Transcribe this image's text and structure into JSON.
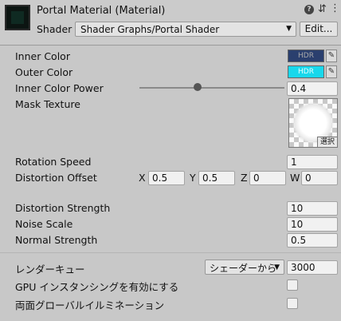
{
  "header": {
    "title": "Portal Material (Material)",
    "help_icon": "?",
    "shader_label": "Shader",
    "shader_value": "Shader Graphs/Portal Shader",
    "edit_label": "Edit..."
  },
  "properties": {
    "inner_color": {
      "label": "Inner Color",
      "hdr": "HDR",
      "color": "#2a3f6e"
    },
    "outer_color": {
      "label": "Outer Color",
      "hdr": "HDR",
      "color": "#18d8ec"
    },
    "inner_power": {
      "label": "Inner Color Power",
      "value": "0.4",
      "slider_fraction": 0.4
    },
    "mask_texture": {
      "label": "Mask Texture",
      "select_label": "選択"
    },
    "rotation_speed": {
      "label": "Rotation Speed",
      "value": "1"
    },
    "distortion_offset": {
      "label": "Distortion Offset",
      "x_label": "X",
      "x": "0.5",
      "y_label": "Y",
      "y": "0.5",
      "z_label": "Z",
      "z": "0",
      "w_label": "W",
      "w": "0"
    },
    "distortion_strength": {
      "label": "Distortion Strength",
      "value": "10"
    },
    "noise_scale": {
      "label": "Noise Scale",
      "value": "10"
    },
    "normal_strength": {
      "label": "Normal Strength",
      "value": "0.5"
    }
  },
  "advanced": {
    "render_queue_label": "レンダーキュー",
    "render_queue_mode": "シェーダーから",
    "render_queue_value": "3000",
    "gpu_instancing_label": "GPU インスタンシングを有効にする",
    "gpu_instancing": false,
    "double_sided_gi_label": "両面グローバルイルミネーション",
    "double_sided_gi": false
  }
}
